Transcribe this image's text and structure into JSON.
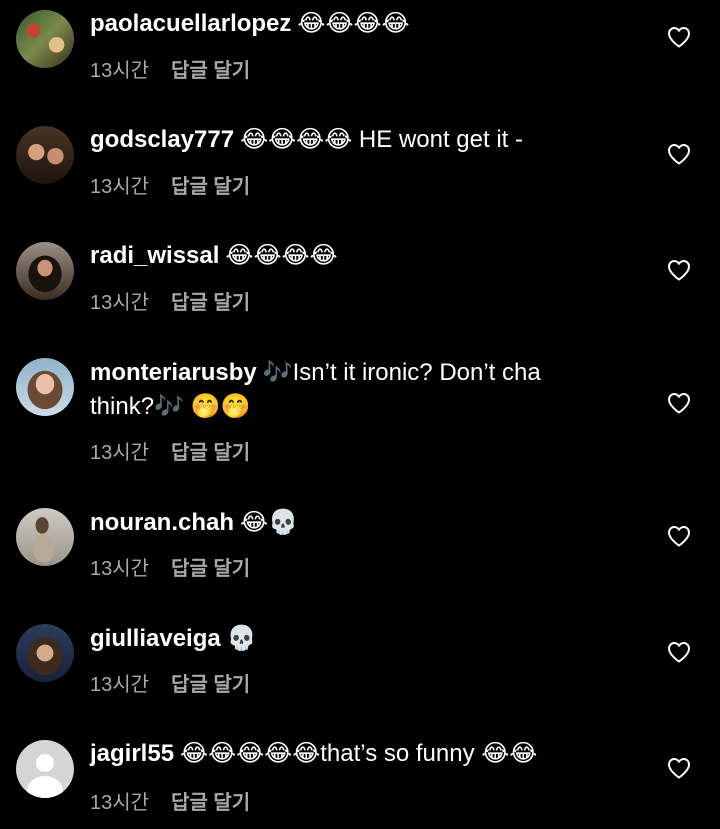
{
  "comments": [
    {
      "username": "paolacuellarlopez",
      "text": "😂😂😂😂",
      "time": "13시간",
      "reply_label": "답글 달기"
    },
    {
      "username": "godsclay777",
      "text": "😂😂😂😂 HE wont get it -",
      "time": "13시간",
      "reply_label": "답글 달기"
    },
    {
      "username": "radi_wissal",
      "text": "😂😂😂😂",
      "time": "13시간",
      "reply_label": "답글 달기"
    },
    {
      "username": "monteriarusby",
      "text": "🎶Isn’t it ironic? Don’t cha think?🎶 🤭🤭",
      "time": "13시간",
      "reply_label": "답글 달기"
    },
    {
      "username": "nouran.chah",
      "text": "😂💀",
      "time": "13시간",
      "reply_label": "답글 달기"
    },
    {
      "username": "giulliaveiga",
      "text": "💀",
      "time": "13시간",
      "reply_label": "답글 달기"
    },
    {
      "username": "jagirl55",
      "text": "😂😂😂😂😂that’s so funny 😂😂",
      "time": "13시간",
      "reply_label": "답글 달기"
    }
  ],
  "icons": {
    "like": "heart-outline-icon",
    "avatar_placeholder": "default-user-icon"
  },
  "colors": {
    "background": "#000000",
    "primary_text": "#ffffff",
    "secondary_text": "#a8a8a8"
  }
}
